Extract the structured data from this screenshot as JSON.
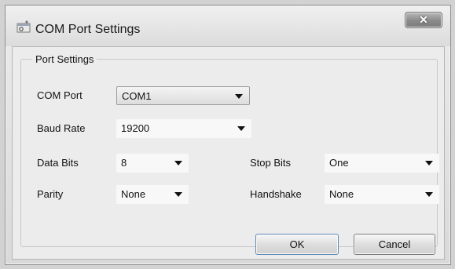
{
  "window": {
    "title": "COM Port Settings",
    "icon": "gear-window-icon",
    "close_label": "✕"
  },
  "group": {
    "title": "Port Settings"
  },
  "fields": {
    "com_port": {
      "label": "COM Port",
      "value": "COM1"
    },
    "baud_rate": {
      "label": "Baud Rate",
      "value": "19200"
    },
    "data_bits": {
      "label": "Data Bits",
      "value": "8"
    },
    "parity": {
      "label": "Parity",
      "value": "None"
    },
    "stop_bits": {
      "label": "Stop Bits",
      "value": "One"
    },
    "handshake": {
      "label": "Handshake",
      "value": "None"
    }
  },
  "buttons": {
    "ok": "OK",
    "cancel": "Cancel"
  }
}
